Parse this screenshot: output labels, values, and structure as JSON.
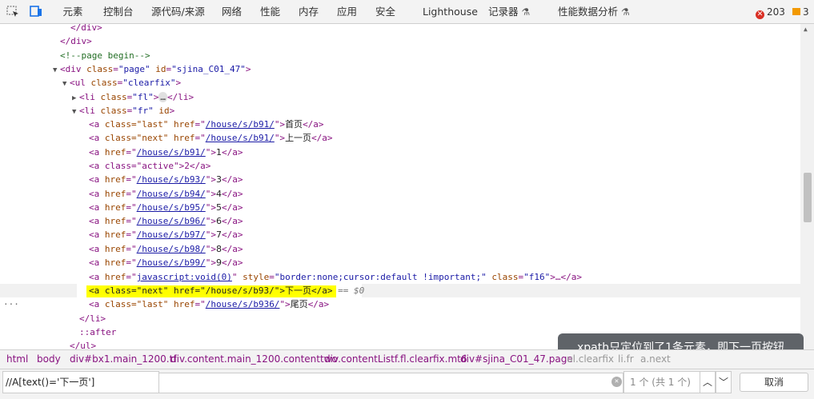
{
  "tabs": [
    {
      "label": "元素",
      "active": true
    },
    {
      "label": "控制台"
    },
    {
      "label": "源代码/来源"
    },
    {
      "label": "网络"
    },
    {
      "label": "性能"
    },
    {
      "label": "内存"
    },
    {
      "label": "应用"
    },
    {
      "label": "安全"
    },
    {
      "label": "Lighthouse"
    },
    {
      "label": "记录器",
      "experimental": true
    },
    {
      "label": "性能数据分析",
      "experimental": true
    }
  ],
  "counters": {
    "errors": "203",
    "warnings": "3"
  },
  "dom": {
    "close_div_1": "</div>",
    "close_div_2": "</div>",
    "comment": "<!--page begin-->",
    "div_page": {
      "tag_open": "<div ",
      "a1": "class",
      "v1": "\"page\"",
      "a2": "id",
      "v2": "\"sjina_C01_47\"",
      "end": ">"
    },
    "ul": {
      "tag_open": "<ul ",
      "a1": "class",
      "v1": "\"clearfix\"",
      "end": ">"
    },
    "li_fl": {
      "tag_open": "<li ",
      "a1": "class",
      "v1": "\"fl\"",
      "end": ">",
      "ellipsis": "…",
      "close": "</li>"
    },
    "li_fr": {
      "tag_open": "<li ",
      "a1": "class",
      "v1": "\"fr\"",
      "a2": "id",
      "end": ">"
    },
    "links": [
      {
        "attrs": "class=\"last\" ",
        "href": "/house/s/b91/",
        "text": "首页"
      },
      {
        "attrs": "class=\"next\" ",
        "href": "/house/s/b91/",
        "text": "上一页"
      },
      {
        "attrs": "",
        "href": "/house/s/b91/",
        "text": "1"
      },
      {
        "active_line": "<a class=\"active\">2</a>"
      },
      {
        "attrs": "",
        "href": "/house/s/b93/",
        "text": "3"
      },
      {
        "attrs": "",
        "href": "/house/s/b94/",
        "text": "4"
      },
      {
        "attrs": "",
        "href": "/house/s/b95/",
        "text": "5"
      },
      {
        "attrs": "",
        "href": "/house/s/b96/",
        "text": "6"
      },
      {
        "attrs": "",
        "href": "/house/s/b97/",
        "text": "7"
      },
      {
        "attrs": "",
        "href": "/house/s/b98/",
        "text": "8"
      },
      {
        "attrs": "",
        "href": "/house/s/b99/",
        "text": "9"
      }
    ],
    "js_link": {
      "href": "javascript:void(0)",
      "style": "\"border:none;cursor:default !important;\"",
      "cls": "\"f16\"",
      "rest": ">…</a>"
    },
    "selected_line": "<a class=\"next\" href=\"/house/s/b93/\">下一页</a>",
    "dollar": "== $0",
    "last_link": {
      "attrs": "class=\"last\" ",
      "href": "/house/s/b936/",
      "text": "尾页"
    },
    "close_li": "</li>",
    "after": "::after",
    "close_ul": "</ul>"
  },
  "breadcrumbs": [
    "html",
    "body",
    "div#bx1.main_1200.tf",
    "div.content.main_1200.contenttwo",
    "div.contentListf.fl.clearfix.mt6",
    "div#sjina_C01_47.page",
    "ul.clearfix",
    "li.fr",
    "a.next"
  ],
  "tooltip": "xpath只定位到了1条元素，即下一页按钮",
  "search": {
    "value": "//A[text()='下一页']",
    "count": "1 个 (共 1 个)",
    "cancel": "取消"
  }
}
